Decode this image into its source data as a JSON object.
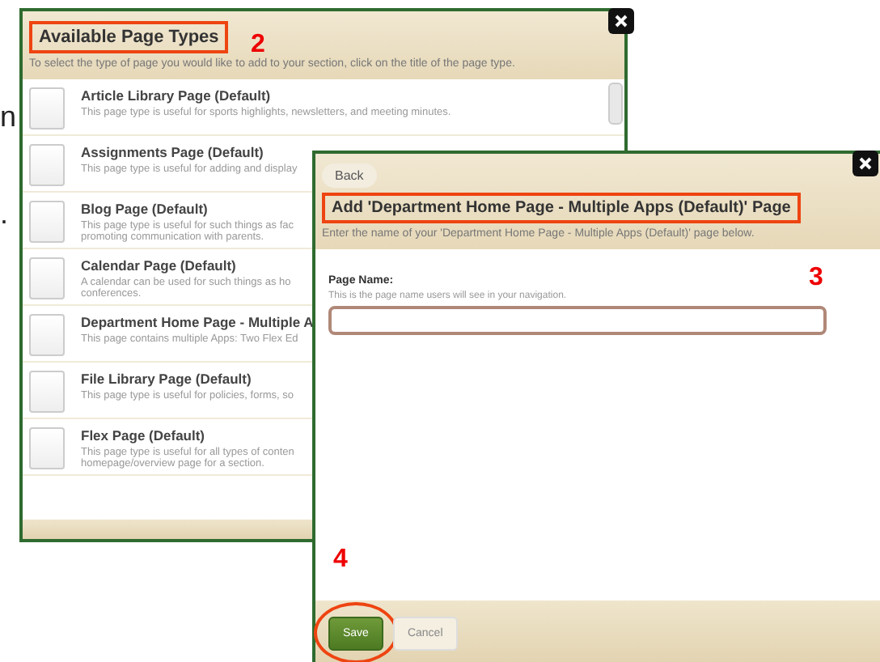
{
  "background_text": [
    "n",
    "."
  ],
  "page_types_dialog": {
    "title": "Available Page Types",
    "title_highlighted": true,
    "subtitle": "To select the type of page you would like to add to your section, click on the title of the page type.",
    "items": [
      {
        "title": "Article Library Page (Default)",
        "description": "This page type is useful for sports highlights, newsletters, and meeting minutes."
      },
      {
        "title": "Assignments Page (Default)",
        "description": "This page type is useful for adding and display"
      },
      {
        "title": "Blog Page (Default)",
        "description": "This page type is useful for such things as fac promoting communication with parents."
      },
      {
        "title": "Calendar Page (Default)",
        "description": "A calendar can be used for such things as ho conferences."
      },
      {
        "title": "Department Home Page - Multiple A",
        "description": "This page contains multiple Apps: Two Flex Ed"
      },
      {
        "title": "File Library Page (Default)",
        "description": "This page type is useful for policies, forms, so"
      },
      {
        "title": "Flex Page (Default)",
        "description": "This page type is useful for all types of conten homepage/overview page for a section."
      }
    ]
  },
  "add_page_dialog": {
    "back": "Back",
    "title": "Add 'Department Home Page - Multiple Apps (Default)' Page",
    "title_highlighted": true,
    "subtitle": "Enter the name of your 'Department Home Page - Multiple Apps (Default)' page below.",
    "field_label": "Page Name:",
    "field_hint": "This is the page name users will see in your navigation.",
    "buttons": [
      {
        "label": "Save",
        "kind": "primary",
        "circled": true
      },
      {
        "label": "Cancel",
        "kind": "secondary",
        "circled": false
      }
    ]
  },
  "annotations": [
    "2",
    "3",
    "4"
  ]
}
